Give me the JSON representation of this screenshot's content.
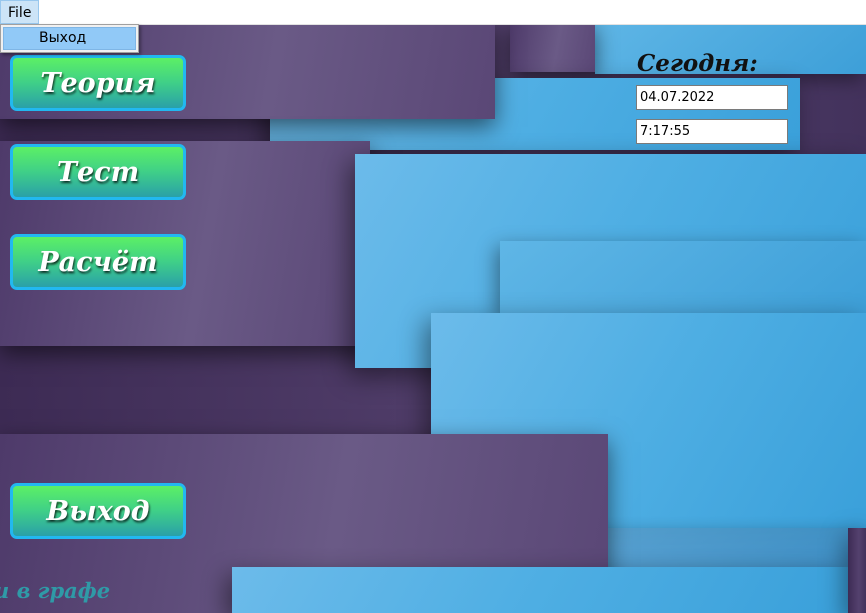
{
  "menubar": {
    "file_label": "File",
    "dropdown_items": [
      "Выход"
    ]
  },
  "nav": {
    "theory": "Теория",
    "test": "Тест",
    "calc": "Расчёт",
    "exit": "Выход"
  },
  "clock": {
    "label": "Сегодня:",
    "date": "04.07.2022",
    "time": "7:17:55"
  },
  "footer": {
    "caption_fragment": "и в графе"
  }
}
